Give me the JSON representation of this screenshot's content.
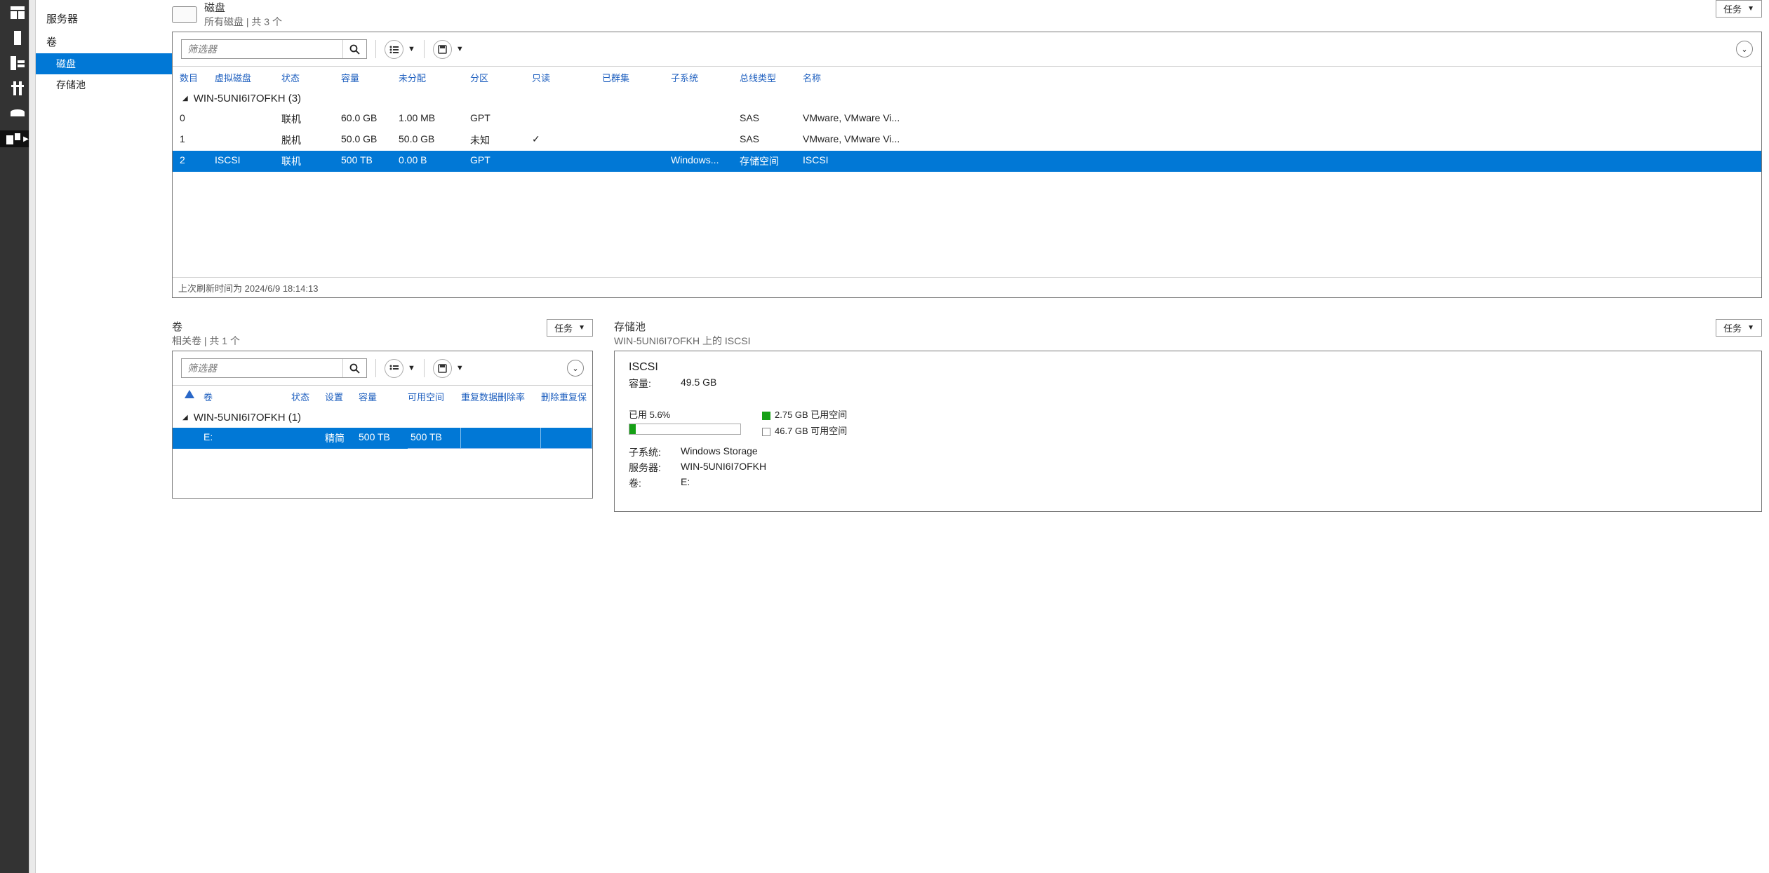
{
  "nav": {
    "servers": "服务器",
    "volumes": "卷",
    "disks": "磁盘",
    "pools": "存储池"
  },
  "disks_panel": {
    "title": "磁盘",
    "subtitle": "所有磁盘 | 共 3 个",
    "tasks": "任务",
    "filter_placeholder": "筛选器",
    "columns": {
      "num": "数目",
      "vdisk": "虚拟磁盘",
      "state": "状态",
      "cap": "容量",
      "unalloc": "未分配",
      "part": "分区",
      "ro": "只读",
      "cluster": "已群集",
      "subsys": "子系统",
      "bus": "总线类型",
      "name": "名称"
    },
    "group": "WIN-5UNI6I7OFKH (3)",
    "rows": [
      {
        "num": "0",
        "vdisk": "",
        "state": "联机",
        "cap": "60.0 GB",
        "unalloc": "1.00 MB",
        "part": "GPT",
        "ro": "",
        "cluster": "",
        "subsys": "",
        "bus": "SAS",
        "name": "VMware, VMware Vi..."
      },
      {
        "num": "1",
        "vdisk": "",
        "state": "脱机",
        "cap": "50.0 GB",
        "unalloc": "50.0 GB",
        "part": "未知",
        "ro": "✓",
        "cluster": "",
        "subsys": "",
        "bus": "SAS",
        "name": "VMware, VMware Vi..."
      },
      {
        "num": "2",
        "vdisk": "ISCSI",
        "state": "联机",
        "cap": "500 TB",
        "unalloc": "0.00 B",
        "part": "GPT",
        "ro": "",
        "cluster": "",
        "subsys": "Windows...",
        "bus": "存储空间",
        "name": "ISCSI",
        "selected": true
      }
    ],
    "footer": "上次刷新时间为 2024/6/9 18:14:13"
  },
  "volumes_panel": {
    "title": "卷",
    "subtitle": "相关卷 | 共 1 个",
    "tasks": "任务",
    "filter_placeholder": "筛选器",
    "columns": {
      "warn": "",
      "vol": "卷",
      "state": "状态",
      "setup": "设置",
      "cap": "容量",
      "free": "可用空间",
      "dedup": "重复数据删除率",
      "dedup2": "删除重复保"
    },
    "group": "WIN-5UNI6I7OFKH (1)",
    "rows": [
      {
        "vol": "E:",
        "state": "",
        "setup": "精简",
        "cap": "500 TB",
        "free": "500 TB",
        "dedup": "",
        "dedup2": "",
        "selected": true
      }
    ]
  },
  "pool_panel": {
    "title": "存储池",
    "subtitle": "WIN-5UNI6I7OFKH 上的 ISCSI",
    "tasks": "任务",
    "name": "ISCSI",
    "cap_label": "容量:",
    "cap_val": "49.5 GB",
    "used_label": "已用 5.6%",
    "used_legend": "2.75 GB 已用空间",
    "free_legend": "46.7 GB 可用空间",
    "subsys_k": "子系统:",
    "subsys_v": "Windows Storage",
    "server_k": "服务器:",
    "server_v": "WIN-5UNI6I7OFKH",
    "vol_k": "卷:",
    "vol_v": "E:"
  }
}
